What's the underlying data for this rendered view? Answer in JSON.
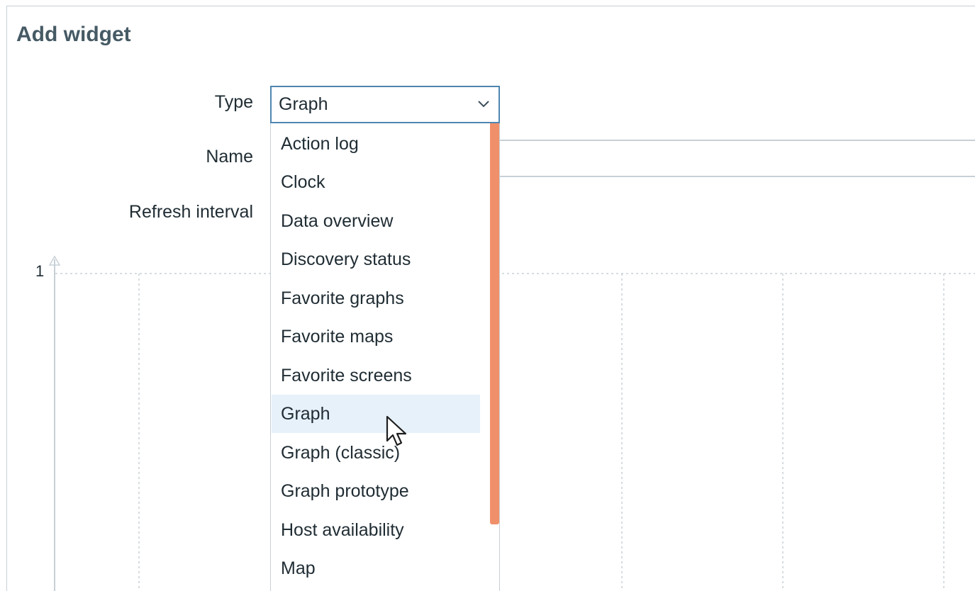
{
  "dialog": {
    "title": "Add widget"
  },
  "form": {
    "type_label": "Type",
    "type_value": "Graph",
    "name_label": "Name",
    "refresh_label": "Refresh interval"
  },
  "preview": {
    "y_tick": "1"
  },
  "dropdown": {
    "items": [
      {
        "label": "Action log"
      },
      {
        "label": "Clock"
      },
      {
        "label": "Data overview"
      },
      {
        "label": "Discovery status"
      },
      {
        "label": "Favorite graphs"
      },
      {
        "label": "Favorite maps"
      },
      {
        "label": "Favorite screens"
      },
      {
        "label": "Graph"
      },
      {
        "label": "Graph (classic)"
      },
      {
        "label": "Graph prototype"
      },
      {
        "label": "Host availability"
      },
      {
        "label": "Map"
      }
    ],
    "hovered_item": "Graph"
  },
  "colors": {
    "title": "#455a64",
    "select_border": "#4f86b0",
    "hover_bg": "#e6f1fa",
    "scrollbar": "#f0906a"
  },
  "icons": {
    "select_arrow": "chevron-down-icon",
    "pointer": "mouse-cursor-icon"
  }
}
